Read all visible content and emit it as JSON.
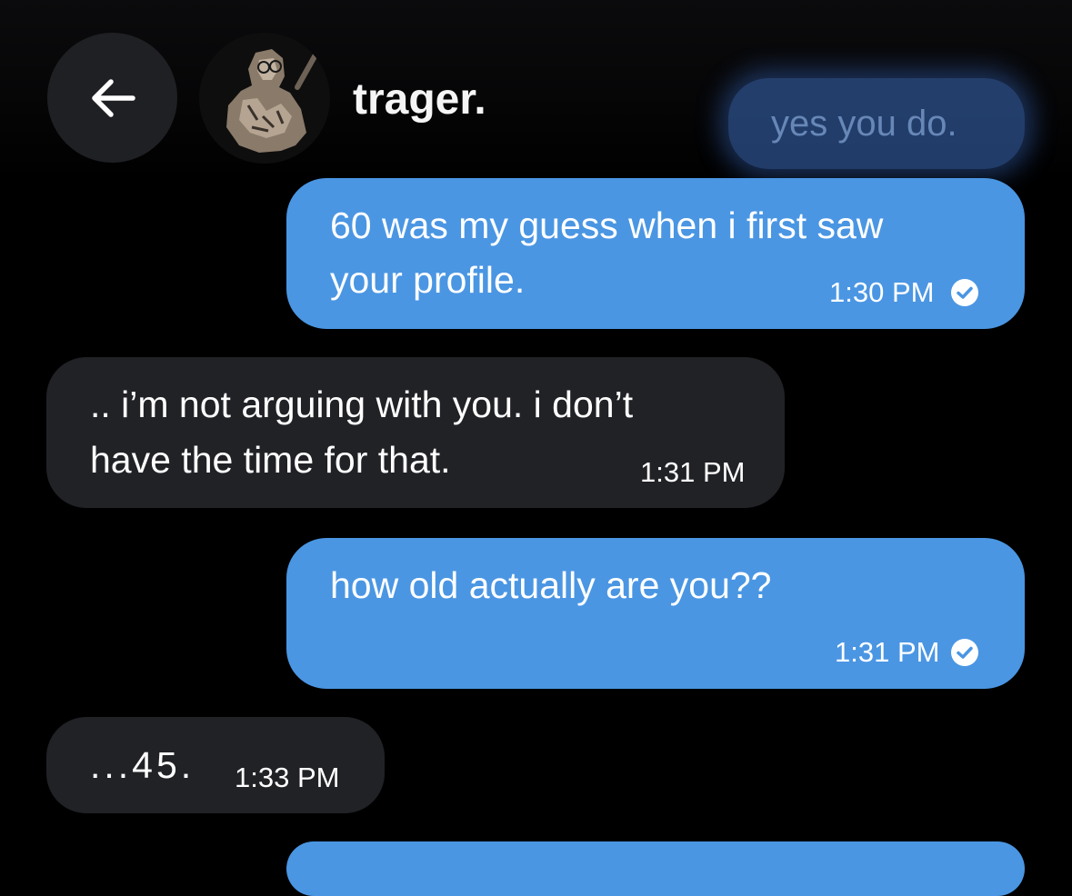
{
  "header": {
    "contact_name": "trager.",
    "back_icon": "arrow-left-icon",
    "avatar_icon": "profile-avatar"
  },
  "ghost_message": {
    "text": "yes you do."
  },
  "messages": [
    {
      "direction": "outgoing",
      "lines": [
        "60 was my guess when i first saw",
        "your profile."
      ],
      "time": "1:30 PM",
      "status_icon": "read-check-icon"
    },
    {
      "direction": "incoming",
      "lines": [
        ".. i’m not arguing with you. i don’t",
        "have the time for that."
      ],
      "time": "1:31 PM"
    },
    {
      "direction": "outgoing",
      "lines": [
        "how old actually are you??"
      ],
      "time": "1:31 PM",
      "status_icon": "read-check-icon"
    },
    {
      "direction": "incoming",
      "lines": [
        "...45."
      ],
      "time": "1:33 PM"
    }
  ],
  "colors": {
    "background": "#000000",
    "outgoing_bubble": "#4a96e3",
    "incoming_bubble": "#212226",
    "back_button": "#1f2023"
  }
}
